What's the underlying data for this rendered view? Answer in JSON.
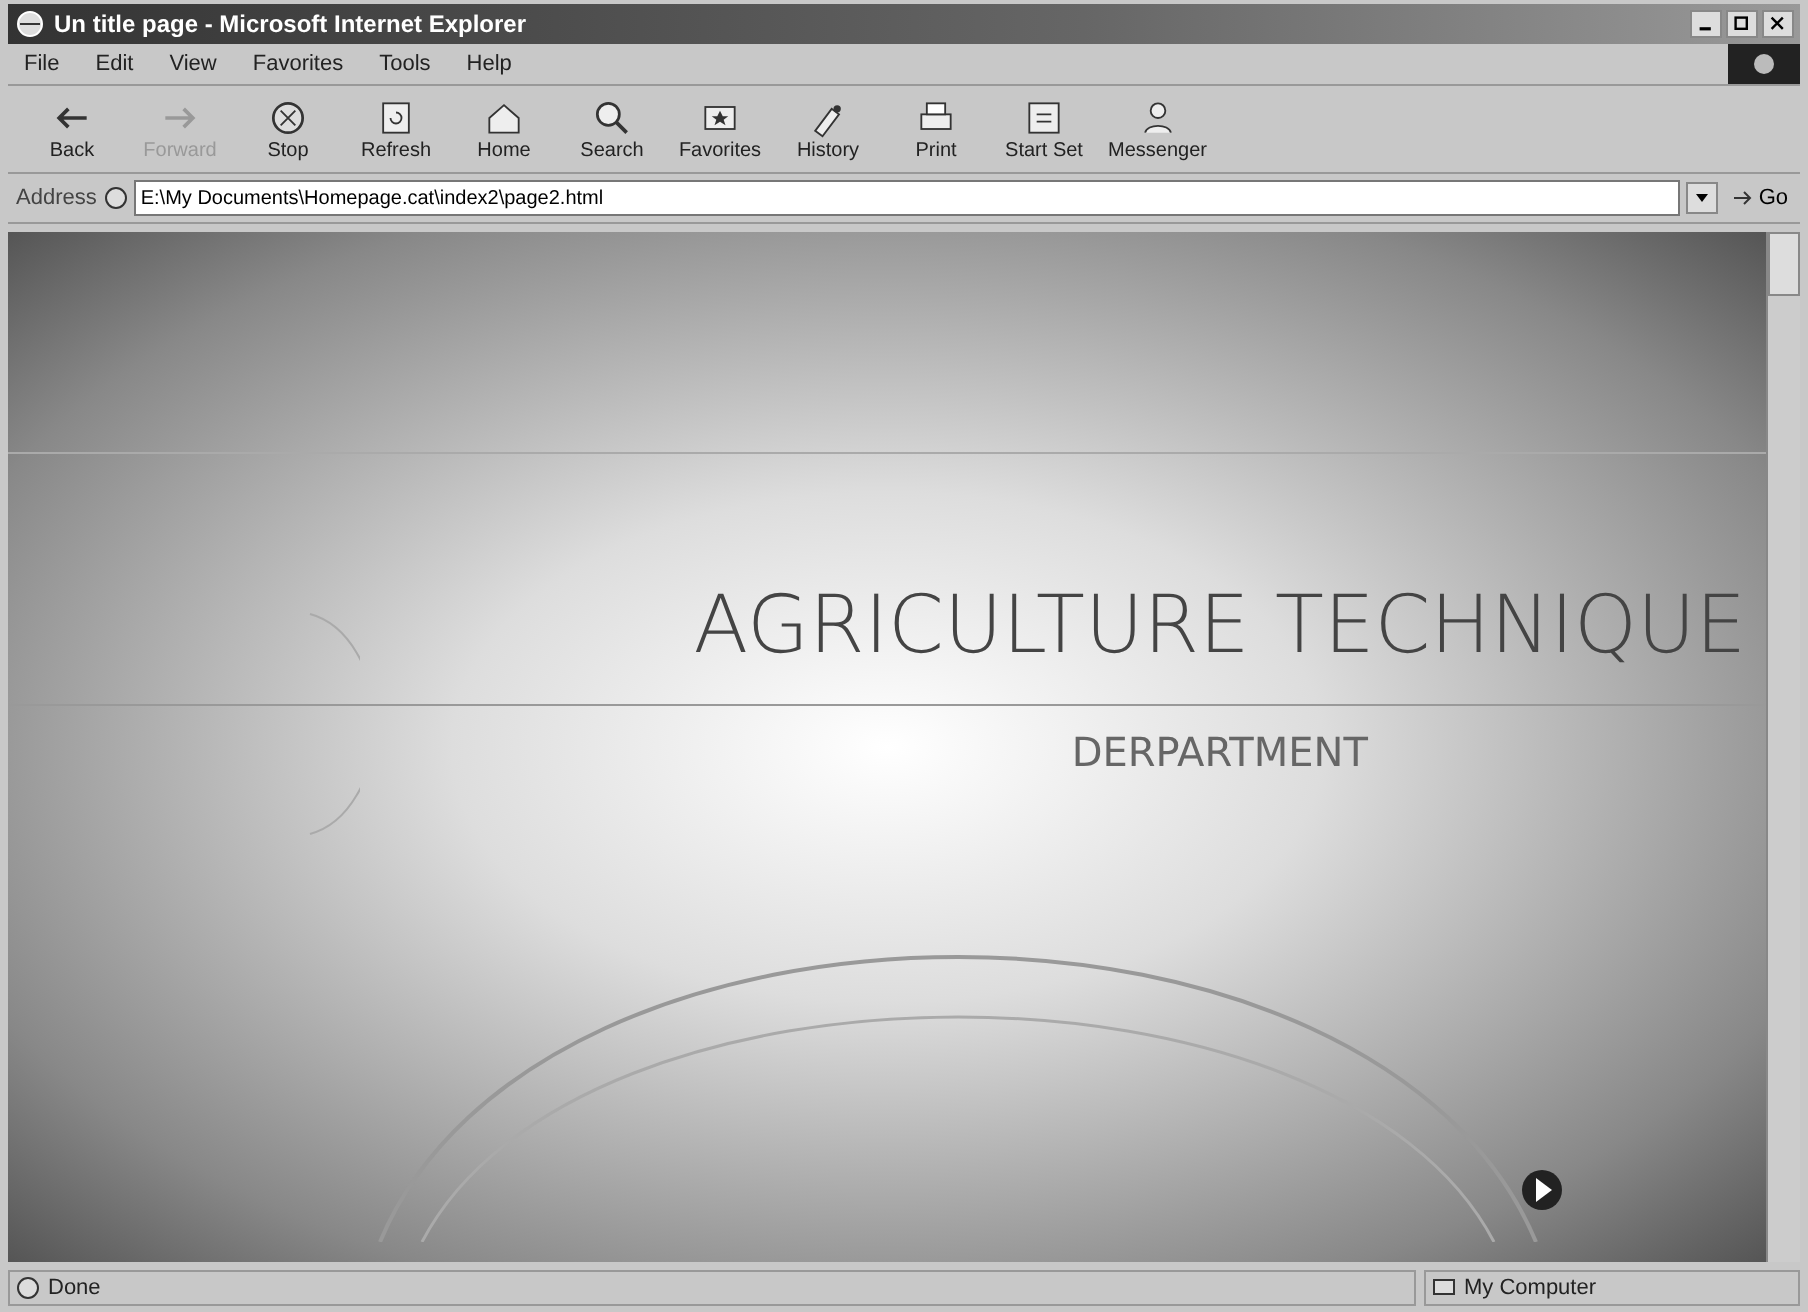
{
  "window": {
    "title": "Un title page - Microsoft Internet Explorer"
  },
  "menu": [
    "File",
    "Edit",
    "View",
    "Favorites",
    "Tools",
    "Help"
  ],
  "toolbar": [
    {
      "kind": "back",
      "label": "Back",
      "disabled": false
    },
    {
      "kind": "forward",
      "label": "Forward",
      "disabled": true
    },
    {
      "kind": "stop",
      "label": "Stop",
      "disabled": false
    },
    {
      "kind": "refresh",
      "label": "Refresh",
      "disabled": false
    },
    {
      "kind": "home",
      "label": "Home",
      "disabled": false
    },
    {
      "kind": "search",
      "label": "Search",
      "disabled": false
    },
    {
      "kind": "favorites",
      "label": "Favorites",
      "disabled": false
    },
    {
      "kind": "history",
      "label": "History",
      "disabled": false
    },
    {
      "kind": "print",
      "label": "Print",
      "disabled": false
    },
    {
      "kind": "start",
      "label": "Start Set",
      "disabled": false
    },
    {
      "kind": "messenger",
      "label": "Messenger",
      "disabled": false
    }
  ],
  "address": {
    "label": "Address",
    "value": "E:\\My Documents\\Homepage.cat\\index2\\page2.html",
    "go": "Go"
  },
  "page": {
    "title": "AGRICULTURE TECHNIQUE",
    "subtitle": "DERPARTMENT"
  },
  "status_bar": {
    "text": "Done",
    "zone": "My Computer"
  }
}
